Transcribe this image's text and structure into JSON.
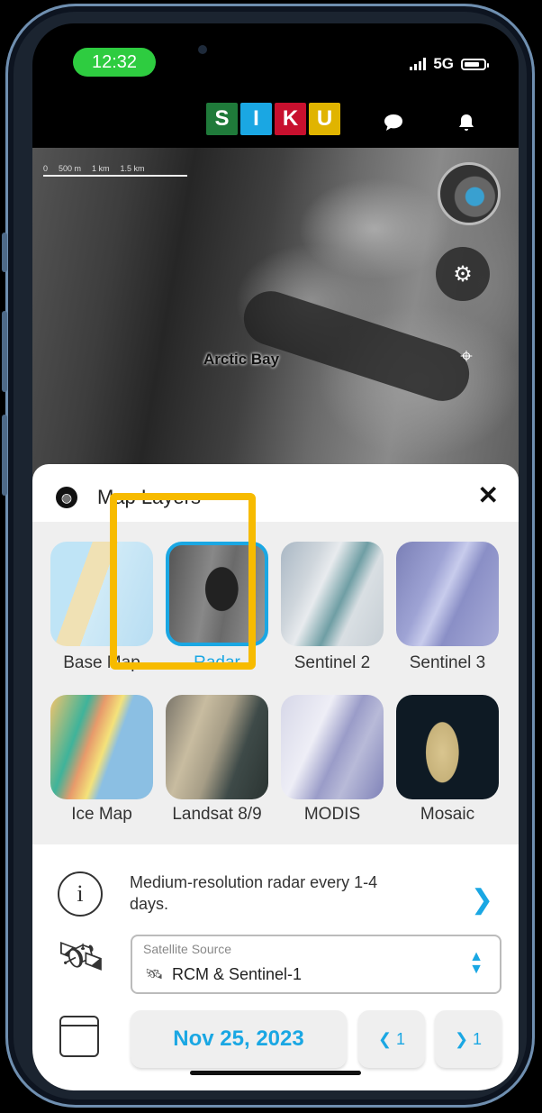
{
  "status_bar": {
    "time": "12:32",
    "network": "5G"
  },
  "header": {
    "logo_letters": [
      "S",
      "I",
      "K",
      "U"
    ],
    "logo_colors": [
      "#1f7a3a",
      "#1aa7e3",
      "#c8102e",
      "#e0b400"
    ]
  },
  "map": {
    "scale_labels": [
      "0",
      "500 m",
      "1 km",
      "1.5 km"
    ],
    "place_label": "Arctic Bay"
  },
  "panel": {
    "title": "Map Layers",
    "layers": [
      {
        "label": "Base Map",
        "selected": false
      },
      {
        "label": "Radar",
        "selected": true
      },
      {
        "label": "Sentinel 2",
        "selected": false
      },
      {
        "label": "Sentinel 3",
        "selected": false
      },
      {
        "label": "Ice Map",
        "selected": false
      },
      {
        "label": "Landsat 8/9",
        "selected": false
      },
      {
        "label": "MODIS",
        "selected": false
      },
      {
        "label": "Mosaic",
        "selected": false
      }
    ],
    "description": "Medium-resolution radar every 1-4 days.",
    "satellite_source": {
      "caption": "Satellite Source",
      "value": "RCM & Sentinel-1"
    },
    "date": "Nov 25, 2023",
    "prev_step": "1",
    "next_step": "1"
  },
  "colors": {
    "accent": "#1aa7e3",
    "highlight": "#f7bb00",
    "status_green": "#2ecc40"
  }
}
